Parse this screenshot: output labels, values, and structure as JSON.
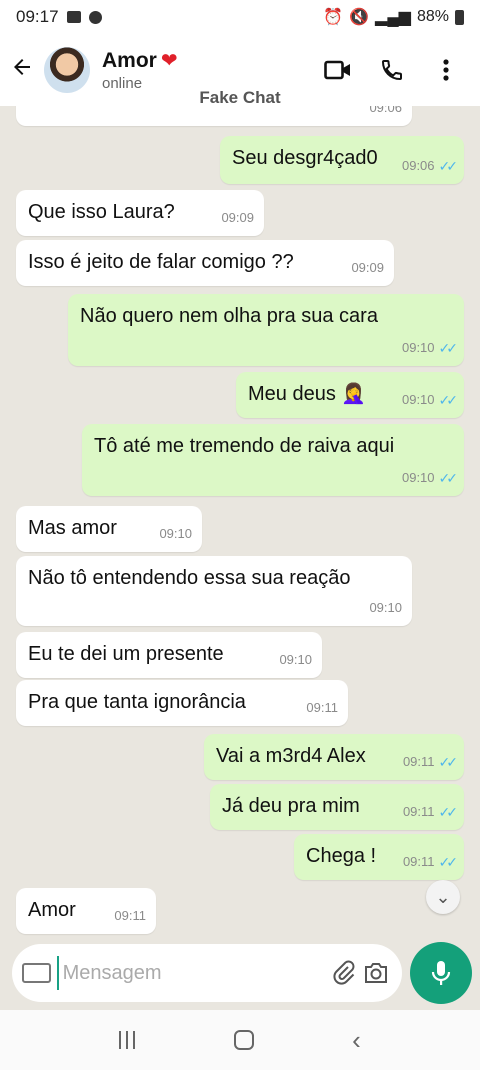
{
  "status_bar": {
    "time": "09:17",
    "battery": "88%"
  },
  "header": {
    "name": "Amor",
    "heart": "❤",
    "status": "online",
    "back_icon": "arrow-left-icon",
    "video_icon": "video-call-icon",
    "call_icon": "phone-icon",
    "menu_icon": "more-vertical-icon"
  },
  "app_label": "Fake Chat",
  "messages": [
    {
      "dir": "out",
      "text": "",
      "time": "09:06",
      "ticks": true
    },
    {
      "dir": "out",
      "text": "Seu desgr4çad0",
      "time": "09:06",
      "ticks": true
    },
    {
      "dir": "in",
      "text": "Que isso  Laura?",
      "time": "09:09"
    },
    {
      "dir": "in",
      "text": "Isso é jeito de falar comigo ??",
      "time": "09:09"
    },
    {
      "dir": "out",
      "text": "Não quero nem olha pra sua cara",
      "time": "09:10",
      "ticks": true
    },
    {
      "dir": "out",
      "text": "Meu deus 🤦‍♀️",
      "time": "09:10",
      "ticks": true
    },
    {
      "dir": "out",
      "text": "Tô até me tremendo de raiva aqui",
      "time": "09:10",
      "ticks": true
    },
    {
      "dir": "in",
      "text": "Mas amor",
      "time": "09:10"
    },
    {
      "dir": "in",
      "text": "Não tô entendendo essa sua reação",
      "time": "09:10"
    },
    {
      "dir": "in",
      "text": "Eu te dei um presente",
      "time": "09:10"
    },
    {
      "dir": "in",
      "text": "Pra que tanta ignorância",
      "time": "09:11"
    },
    {
      "dir": "out",
      "text": "Vai a m3rd4 Alex",
      "time": "09:11",
      "ticks": true
    },
    {
      "dir": "out",
      "text": "Já deu pra mim",
      "time": "09:11",
      "ticks": true
    },
    {
      "dir": "out",
      "text": "Chega !",
      "time": "09:11",
      "ticks": true
    },
    {
      "dir": "in",
      "text": "Amor",
      "time": "09:11"
    }
  ],
  "composer": {
    "placeholder": "Mensagem"
  },
  "colors": {
    "accent": "#14a07a",
    "outgoing_bubble": "#dcf8c6",
    "read_ticks": "#4fb6ec"
  }
}
